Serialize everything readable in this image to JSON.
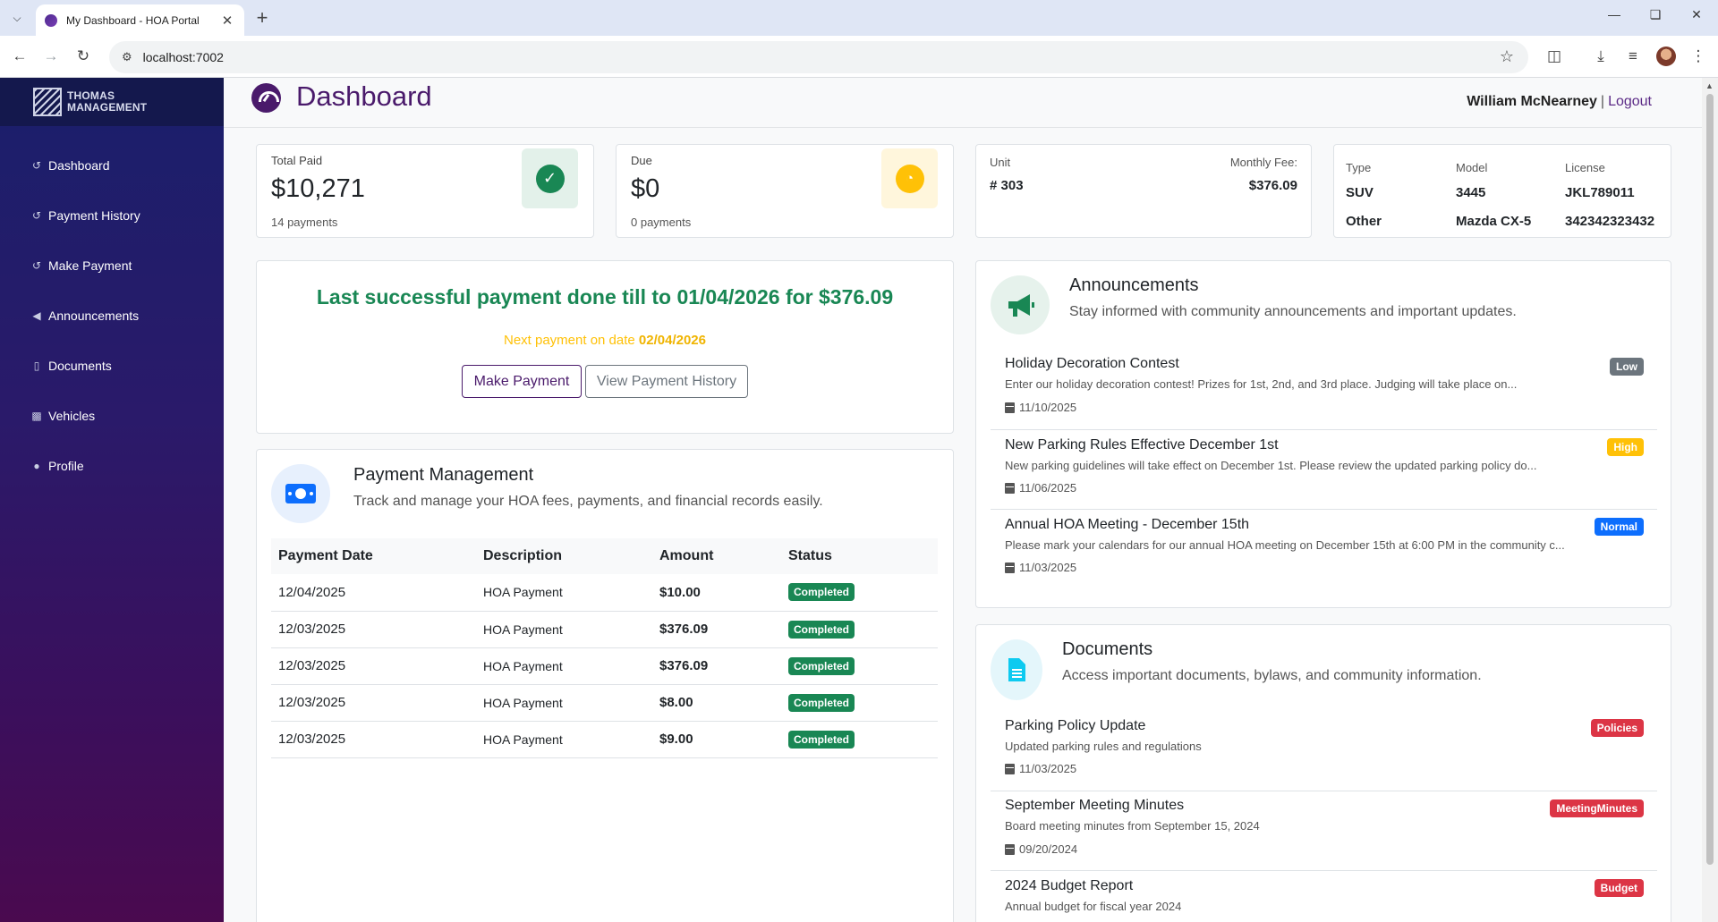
{
  "browser": {
    "tab_title": "My Dashboard - HOA Portal",
    "url": "localhost:7002"
  },
  "sidebar": {
    "brand_line1": "THOMAS",
    "brand_line2": "MANAGEMENT",
    "items": [
      {
        "label": "Dashboard",
        "icon": "history-icon"
      },
      {
        "label": "Payment History",
        "icon": "history-icon"
      },
      {
        "label": "Make Payment",
        "icon": "history-icon"
      },
      {
        "label": "Announcements",
        "icon": "megaphone-icon"
      },
      {
        "label": "Documents",
        "icon": "file-icon"
      },
      {
        "label": "Vehicles",
        "icon": "car-icon"
      },
      {
        "label": "Profile",
        "icon": "user-icon"
      }
    ]
  },
  "header": {
    "title": "Dashboard",
    "user_name": "William McNearney",
    "separator": "|",
    "logout": "Logout"
  },
  "stats": {
    "total_paid": {
      "label": "Total Paid",
      "value": "$10,271",
      "sub": "14 payments",
      "color": "#198754"
    },
    "due": {
      "label": "Due",
      "value": "$0",
      "sub": "0 payments",
      "color": "#ffc107"
    }
  },
  "unit": {
    "unit_label": "Unit",
    "unit_value": "# 303",
    "fee_label": "Monthly Fee:",
    "fee_value": "$376.09"
  },
  "vehicles": {
    "headers": [
      "Type",
      "Model",
      "License"
    ],
    "rows": [
      [
        "SUV",
        "3445",
        "JKL789011"
      ],
      [
        "Other",
        "Mazda CX-5",
        "342342323432"
      ]
    ]
  },
  "hero": {
    "title": "Last successful payment done till to 01/04/2026 for $376.09",
    "next_prefix": "Next payment on date",
    "next_date": "02/04/2026",
    "make_payment": "Make Payment",
    "view_history": "View Payment History"
  },
  "payments": {
    "title": "Payment Management",
    "subtitle": "Track and manage your HOA fees, payments, and financial records easily.",
    "columns": [
      "Payment Date",
      "Description",
      "Amount",
      "Status"
    ],
    "rows": [
      {
        "date": "12/04/2025",
        "desc": "HOA Payment",
        "amount": "$10.00",
        "status": "Completed"
      },
      {
        "date": "12/03/2025",
        "desc": "HOA Payment",
        "amount": "$376.09",
        "status": "Completed"
      },
      {
        "date": "12/03/2025",
        "desc": "HOA Payment",
        "amount": "$376.09",
        "status": "Completed"
      },
      {
        "date": "12/03/2025",
        "desc": "HOA Payment",
        "amount": "$8.00",
        "status": "Completed"
      },
      {
        "date": "12/03/2025",
        "desc": "HOA Payment",
        "amount": "$9.00",
        "status": "Completed"
      }
    ]
  },
  "announcements": {
    "title": "Announcements",
    "subtitle": "Stay informed with community announcements and important updates.",
    "items": [
      {
        "title": "Holiday Decoration Contest",
        "desc": "Enter our holiday decoration contest! Prizes for 1st, 2nd, and 3rd place. Judging will take place on...",
        "date": "11/10/2025",
        "badge": "Low",
        "badge_color": "#6c757d"
      },
      {
        "title": "New Parking Rules Effective December 1st",
        "desc": "New parking guidelines will take effect on December 1st. Please review the updated parking policy do...",
        "date": "11/06/2025",
        "badge": "High",
        "badge_color": "#ffc107"
      },
      {
        "title": "Annual HOA Meeting - December 15th",
        "desc": "Please mark your calendars for our annual HOA meeting on December 15th at 6:00 PM in the community c...",
        "date": "11/03/2025",
        "badge": "Normal",
        "badge_color": "#0d6efd"
      }
    ]
  },
  "documents": {
    "title": "Documents",
    "subtitle": "Access important documents, bylaws, and community information.",
    "items": [
      {
        "title": "Parking Policy Update",
        "desc": "Updated parking rules and regulations",
        "date": "11/03/2025",
        "badge": "Policies",
        "badge_color": "#dc3545"
      },
      {
        "title": "September Meeting Minutes",
        "desc": "Board meeting minutes from September 15, 2024",
        "date": "09/20/2024",
        "badge": "MeetingMinutes",
        "badge_color": "#dc3545"
      },
      {
        "title": "2024 Budget Report",
        "desc": "Annual budget for fiscal year 2024",
        "date": "",
        "badge": "Budget",
        "badge_color": "#dc3545"
      }
    ]
  }
}
